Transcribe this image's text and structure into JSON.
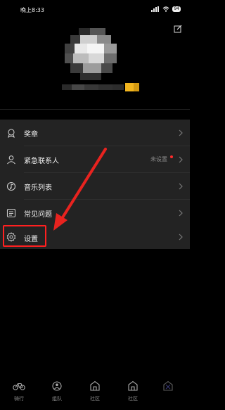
{
  "status_bar": {
    "time": "晚上8:33",
    "battery": "94"
  },
  "menu": {
    "items": [
      {
        "label": "奖章",
        "icon": "medal-icon"
      },
      {
        "label": "紧急联系人",
        "icon": "contact-icon",
        "value": "未设置",
        "badge_dot": true
      },
      {
        "label": "音乐列表",
        "icon": "music-icon"
      },
      {
        "label": "常见问题",
        "icon": "faq-icon"
      }
    ]
  },
  "settings": {
    "label": "设置",
    "icon": "gear-icon"
  },
  "tabbar": {
    "tabs": [
      {
        "label": "骑行",
        "icon": "bike-icon"
      },
      {
        "label": "组队",
        "icon": "team-icon"
      },
      {
        "label": "社区",
        "icon": "community-icon"
      },
      {
        "label": "社区",
        "icon": "community-icon"
      },
      {
        "label": "",
        "icon": "profile-icon"
      }
    ]
  },
  "colors": {
    "background": "#000000",
    "card": "#232323",
    "highlight": "#ff2020",
    "badge": "#ff2b2b",
    "username_accent": "#f2b51e"
  }
}
